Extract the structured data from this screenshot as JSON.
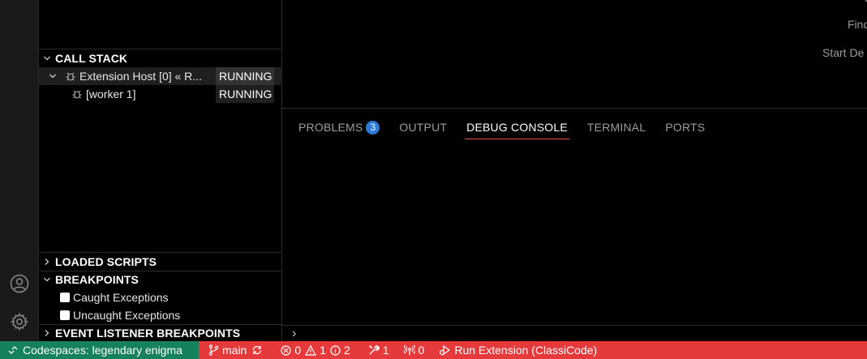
{
  "sidebar": {
    "call_stack": {
      "title": "CALL STACK",
      "threads": [
        {
          "label": "Extension Host [0] « R...",
          "status": "RUNNING"
        },
        {
          "label": "[worker 1]",
          "status": "RUNNING"
        }
      ]
    },
    "loaded_scripts": {
      "title": "LOADED SCRIPTS"
    },
    "breakpoints": {
      "title": "BREAKPOINTS",
      "items": [
        {
          "label": "Caught Exceptions"
        },
        {
          "label": "Uncaught Exceptions"
        }
      ]
    },
    "event_listener_breakpoints": {
      "title": "EVENT LISTENER BREAKPOINTS"
    }
  },
  "editor": {
    "welcome_items": [
      "Find",
      "Start De"
    ]
  },
  "panel": {
    "tabs": [
      {
        "label": "PROBLEMS",
        "badge": "3"
      },
      {
        "label": "OUTPUT"
      },
      {
        "label": "DEBUG CONSOLE"
      },
      {
        "label": "TERMINAL"
      },
      {
        "label": "PORTS"
      }
    ],
    "prompt": "›"
  },
  "status_bar": {
    "remote": "Codespaces: legendary enigma",
    "branch": "main",
    "errors": "0",
    "warnings": "1",
    "info": "2",
    "debug_sessions": "1",
    "ports": "0",
    "run_config": "Run Extension (ClassiCode)"
  },
  "colors": {
    "status_bar_bg": "#e5393b",
    "remote_bg": "#16825d",
    "badge_bg": "#2c7ad6",
    "active_tab_underline": "#f14c4c"
  }
}
